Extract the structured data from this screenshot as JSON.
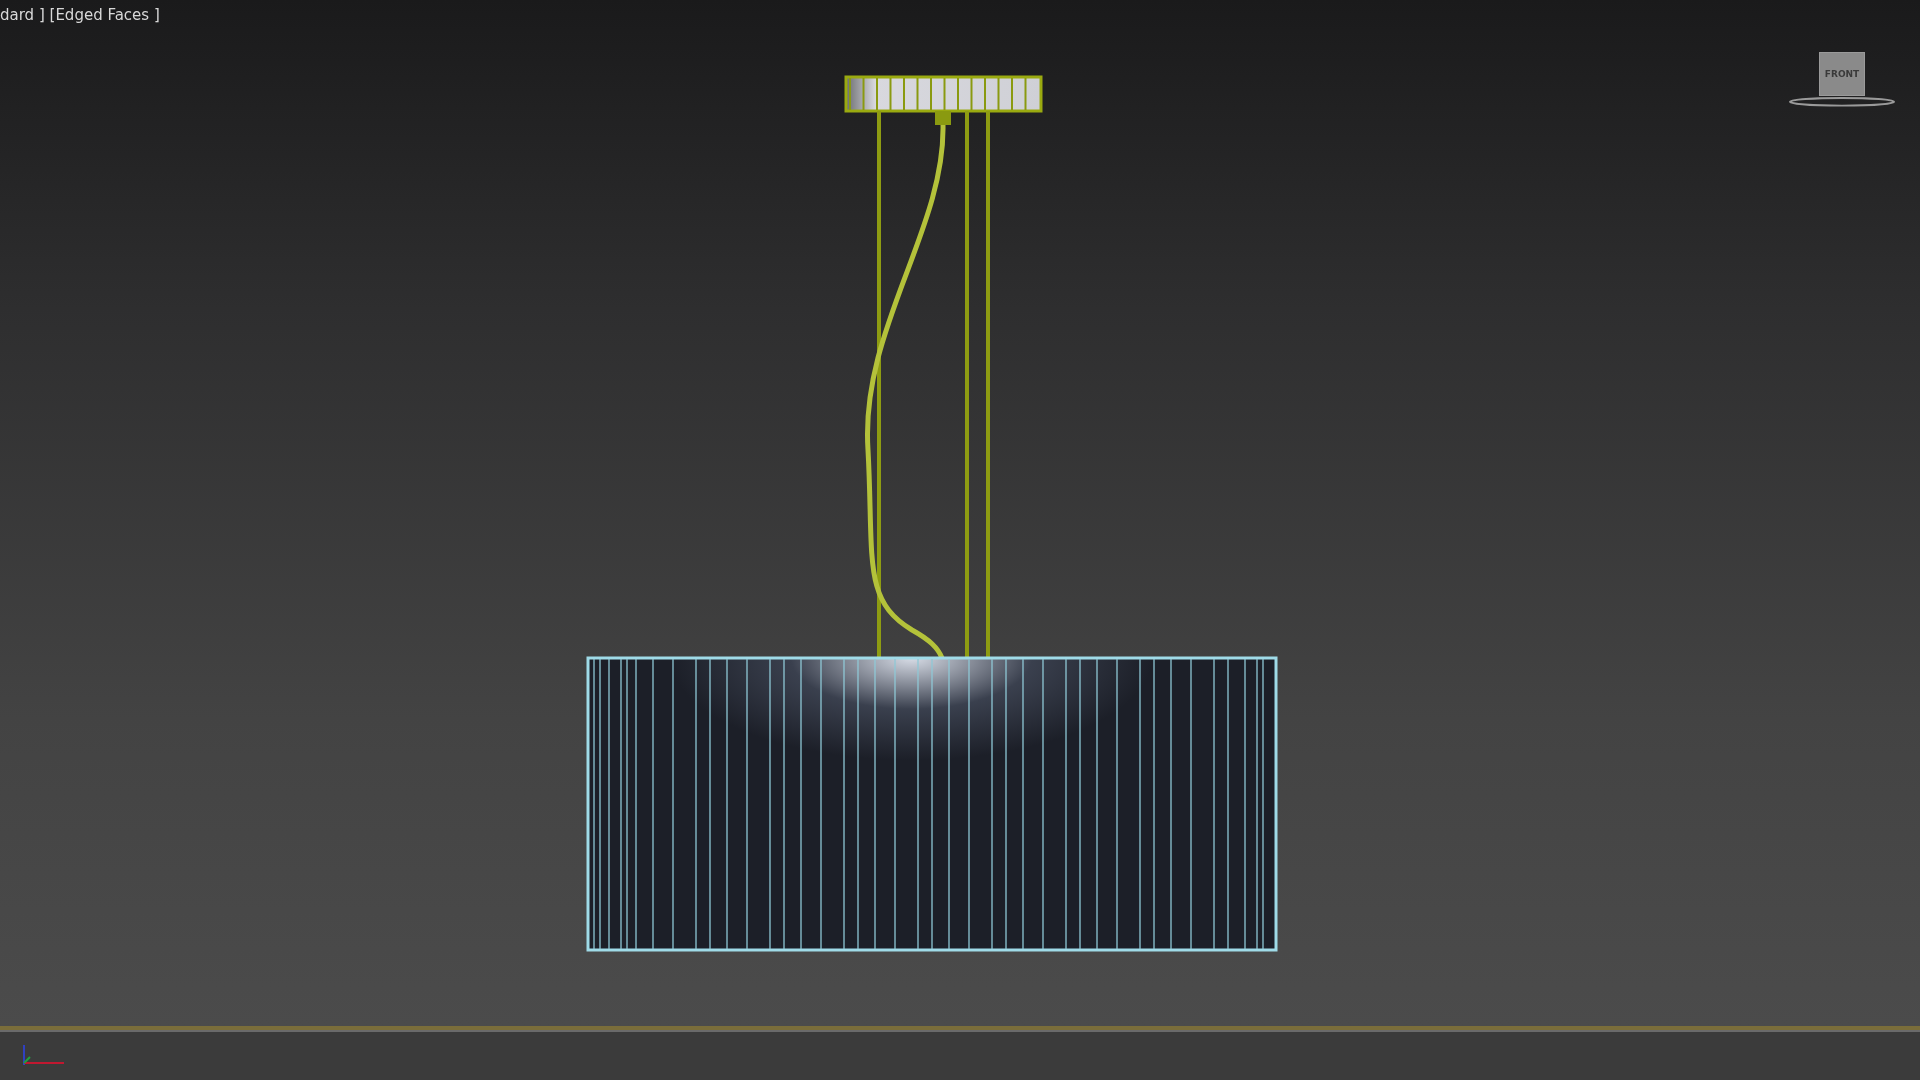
{
  "viewport": {
    "label": "dard ] [Edged Faces ]",
    "viewcube": {
      "face_label": "FRONT"
    }
  }
}
